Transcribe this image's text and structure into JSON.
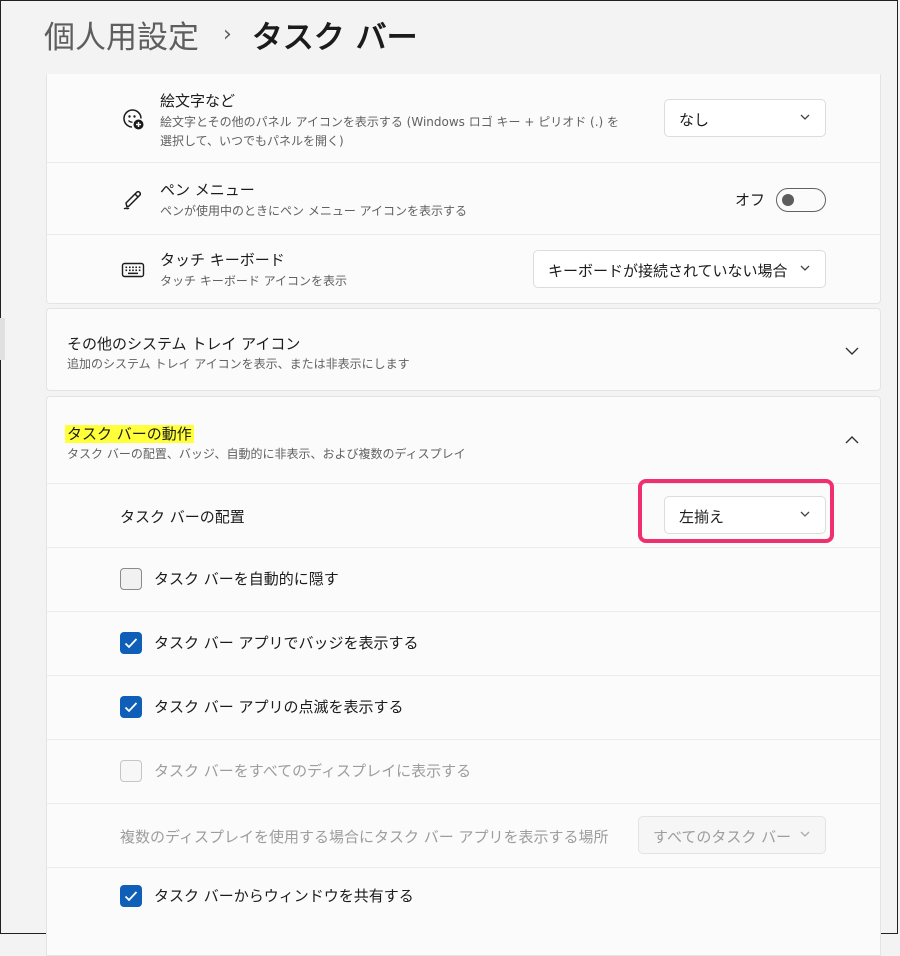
{
  "breadcrumb": {
    "parent": "個人用設定",
    "separator": "›",
    "current": "タスク バー"
  },
  "top_card": {
    "emoji": {
      "icon": "emoji-panel-icon",
      "title": "絵文字など",
      "desc_line1": "絵文字とその他のパネル アイコンを表示する (Windows ロゴ キー + ピリオド (.) を",
      "desc_line2": "選択して、いつでもパネルを開く)",
      "dropdown_value": "なし"
    },
    "pen": {
      "icon": "pen-icon",
      "title": "ペン メニュー",
      "desc": "ペンが使用中のときにペン メニュー アイコンを表示する",
      "toggle_label": "オフ",
      "toggle_state": "off"
    },
    "touch_keyboard": {
      "icon": "keyboard-icon",
      "title": "タッチ キーボード",
      "desc": "タッチ キーボード アイコンを表示",
      "dropdown_value": "キーボードが接続されていない場合"
    }
  },
  "other_tray": {
    "title": "その他のシステム トレイ アイコン",
    "desc": "追加のシステム トレイ アイコンを表示、または非表示にします",
    "expanded": false
  },
  "behaviors": {
    "title": "タスク バーの動作",
    "desc": "タスク バーの配置、バッジ、自動的に非表示、および複数のディスプレイ",
    "expanded": true,
    "alignment": {
      "label": "タスク バーの配置",
      "dropdown_value": "左揃え"
    },
    "checkboxes": [
      {
        "label": "タスク バーを自動的に隠す",
        "checked": false,
        "enabled": true
      },
      {
        "label": "タスク バー アプリでバッジを表示する",
        "checked": true,
        "enabled": true
      },
      {
        "label": "タスク バー アプリの点滅を表示する",
        "checked": true,
        "enabled": true
      },
      {
        "label": "タスク バーをすべてのディスプレイに表示する",
        "checked": false,
        "enabled": false
      }
    ],
    "multi_display": {
      "label": "複数のディスプレイを使用する場合にタスク バー アプリを表示する場所",
      "dropdown_value": "すべてのタスク バー",
      "enabled": false
    },
    "share_window": {
      "label": "タスク バーからウィンドウを共有する",
      "checked": true
    }
  },
  "colors": {
    "accent": "#0f5fb8",
    "highlight": "#ffff3a",
    "annotation": "#f0306e"
  }
}
